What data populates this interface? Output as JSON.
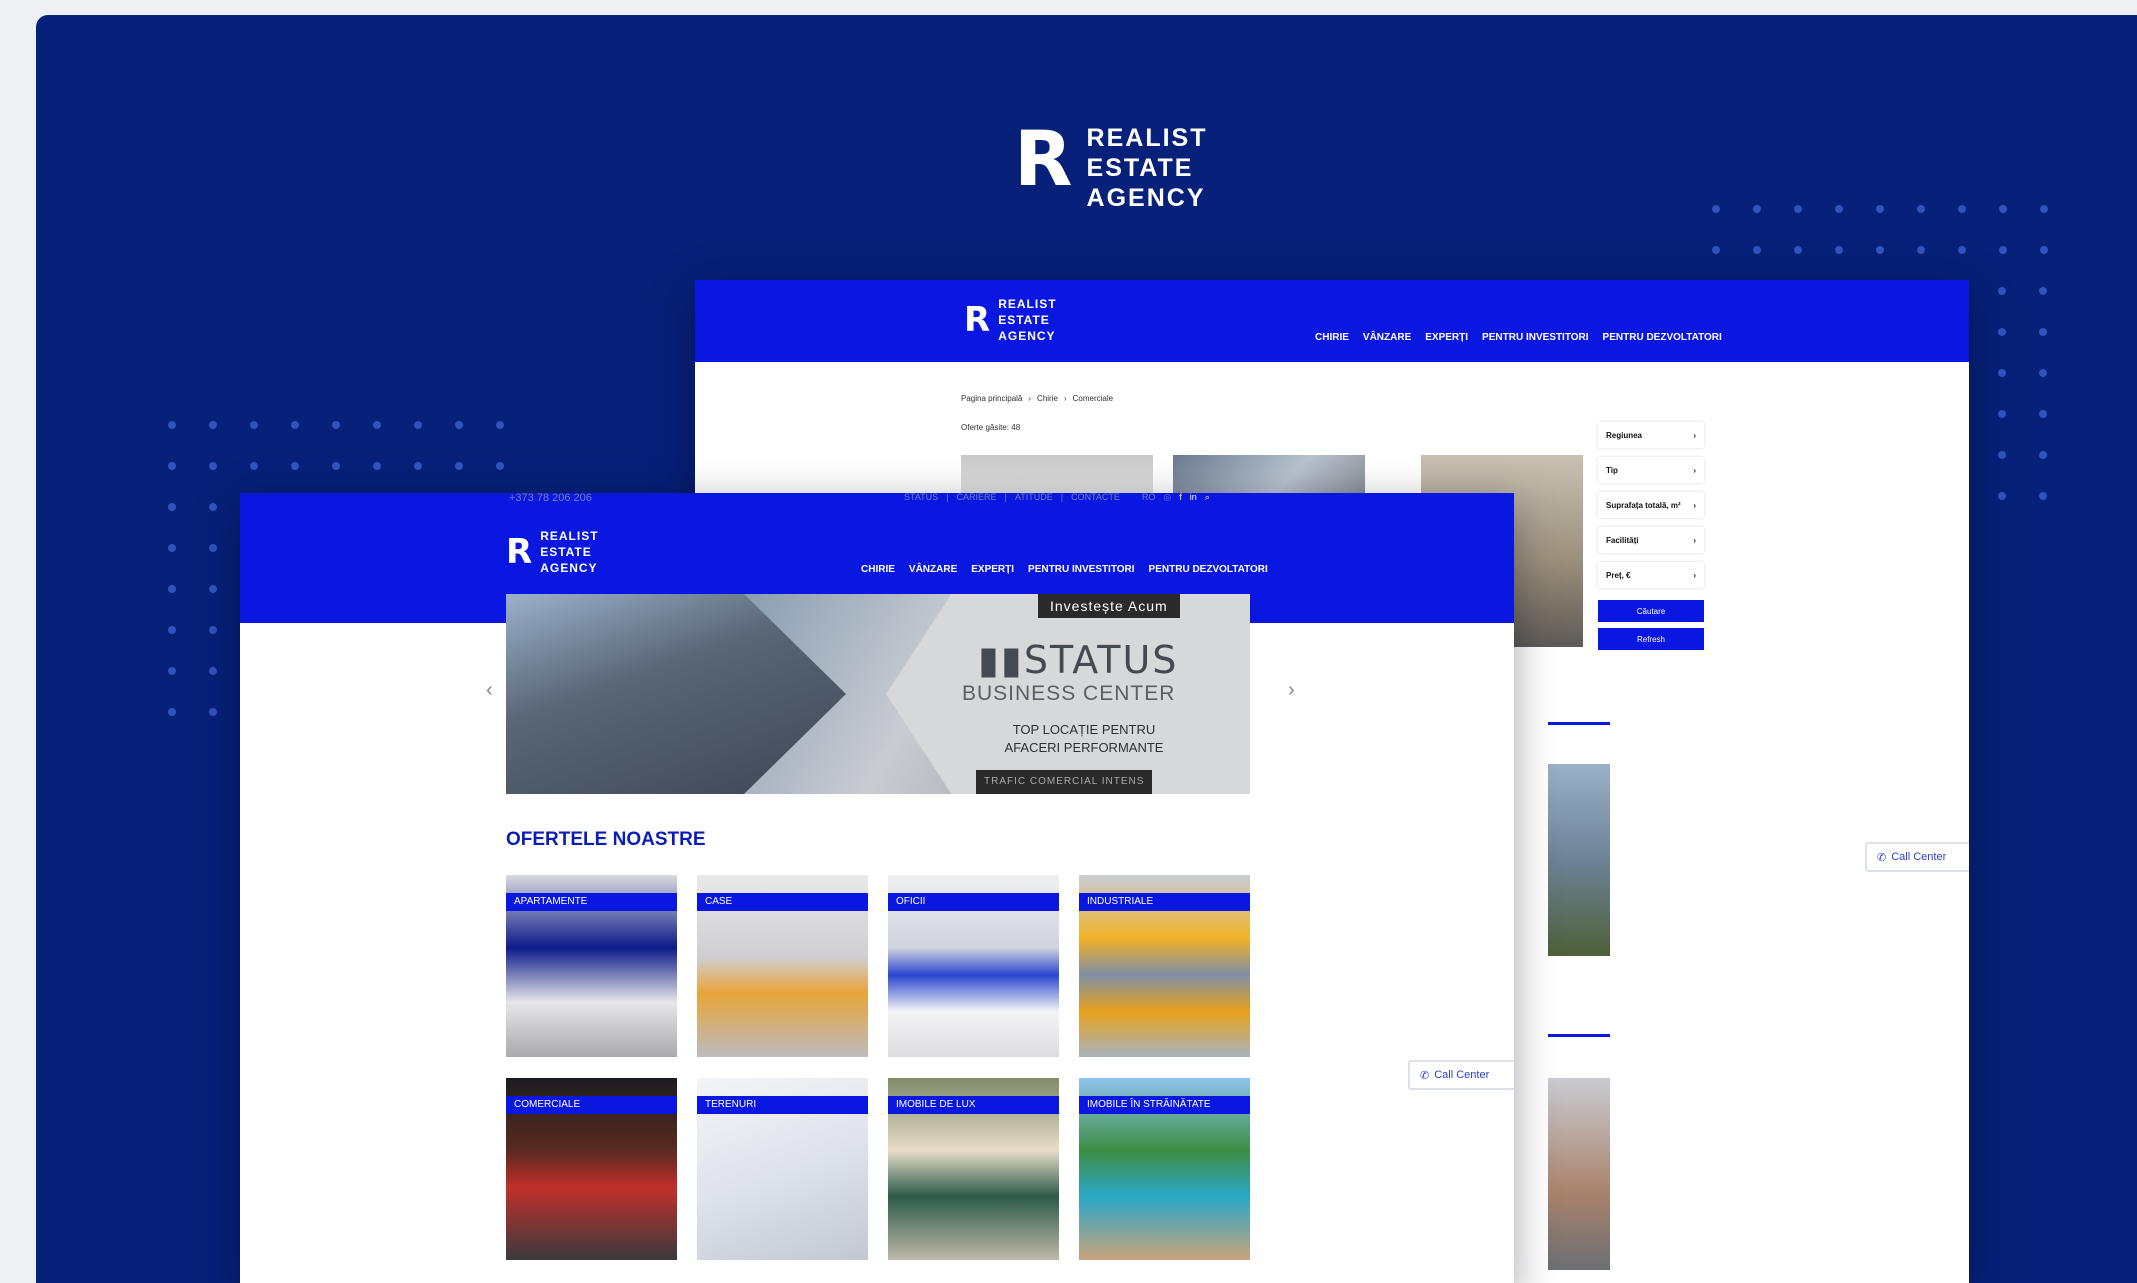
{
  "brand": {
    "mark": "R",
    "lines": [
      "REALIST",
      "ESTATE",
      "AGENCY"
    ]
  },
  "back_window": {
    "nav": [
      "CHIRIE",
      "VÂNZARE",
      "EXPERȚI",
      "PENTRU INVESTITORI",
      "PENTRU DEZVOLTATORI"
    ],
    "breadcrumb": [
      "Pagina principală",
      "Chirie",
      "Comerciale"
    ],
    "results_text": "Oferte găsite: 48",
    "filters": [
      "Regiunea",
      "Tip",
      "Suprafața totală, m²",
      "Facilități",
      "Preț, €"
    ],
    "search_button": "Căutare",
    "reset_button": "Refresh",
    "call_center": "Call Center"
  },
  "front_window": {
    "phone": "+373 78 206 206",
    "top_links": [
      "STATUS",
      "CARIERE",
      "ATITUDE",
      "CONTACTE"
    ],
    "lang": "RO",
    "nav": [
      "CHIRIE",
      "VÂNZARE",
      "EXPERȚI",
      "PENTRU INVESTITORI",
      "PENTRU DEZVOLTATORI"
    ],
    "banner": {
      "cta": "Investește Acum",
      "title": "STATUS",
      "subtitle": "BUSINESS CENTER",
      "tag1": "TOP LOCAȚIE PENTRU",
      "tag2": "AFACERI PERFORMANTE",
      "footer": "TRAFIC COMERCIAL INTENS"
    },
    "section_title": "OFERTELE NOASTRE",
    "categories": [
      "APARTAMENTE",
      "CASE",
      "OFICII",
      "INDUSTRIALE",
      "COMERCIALE",
      "TERENURI",
      "IMOBILE DE LUX",
      "IMOBILE ÎN STRĂINĂTATE"
    ],
    "call_center": "Call Center"
  },
  "colors": {
    "background": "#072079",
    "accent": "#0a17e0"
  },
  "icons": [
    "phone-icon",
    "search-icon",
    "facebook-icon",
    "linkedin-icon",
    "instagram-icon",
    "chevron-left-icon",
    "chevron-right-icon"
  ]
}
